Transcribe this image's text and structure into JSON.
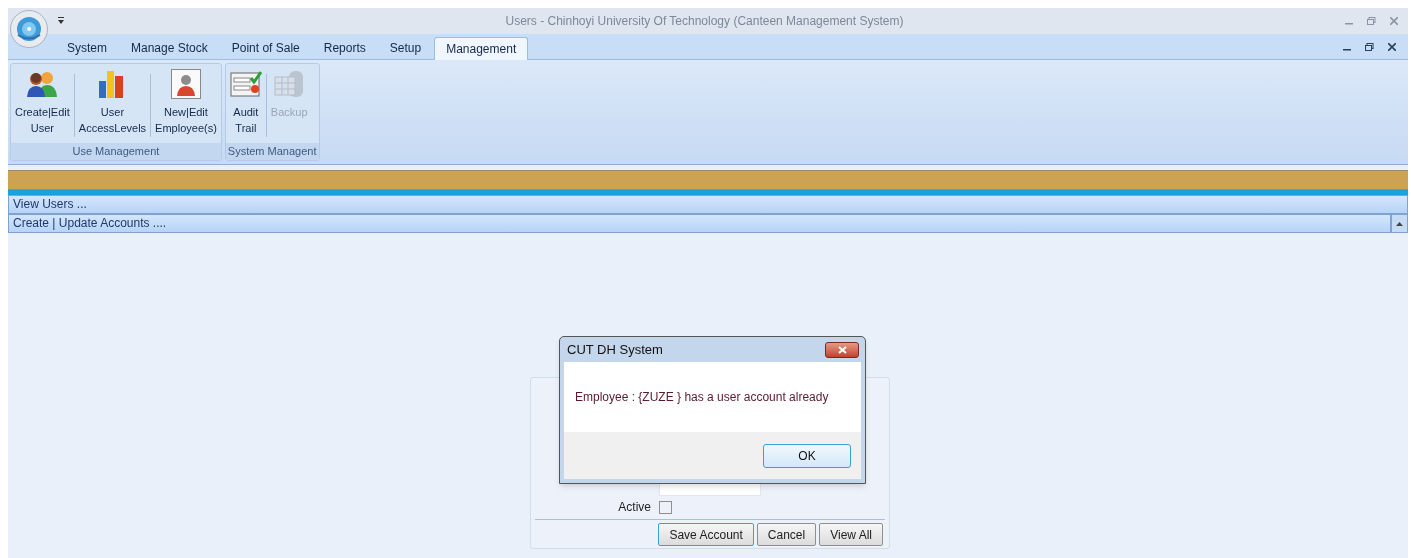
{
  "window": {
    "title": "Users - Chinhoyi University Of Technology (Canteen Management System)"
  },
  "tabs": [
    {
      "label": "System",
      "selected": false
    },
    {
      "label": "Manage Stock",
      "selected": false
    },
    {
      "label": "Point of Sale",
      "selected": false
    },
    {
      "label": "Reports",
      "selected": false
    },
    {
      "label": "Setup",
      "selected": false
    },
    {
      "label": "Management",
      "selected": true
    }
  ],
  "ribbon_groups": [
    {
      "label": "Use Management",
      "buttons": [
        {
          "kind": "users",
          "line_1": "Create|Edit",
          "line_2": "User",
          "disabled": false
        },
        {
          "kind": "chart",
          "line_1": "User",
          "line_2": "AccessLevels",
          "disabled": false
        },
        {
          "kind": "employee",
          "line_1": "New|Edit",
          "line_2": "Employee(s)",
          "disabled": false
        }
      ]
    },
    {
      "label": "System Managent",
      "buttons": [
        {
          "kind": "audit",
          "line_1": "Audit",
          "line_2": "Trail",
          "disabled": false
        },
        {
          "kind": "backup",
          "line_1": "Backup",
          "disabled": true
        }
      ]
    }
  ],
  "panels": [
    {
      "label": "View Users ...",
      "expanded": false
    },
    {
      "label": "Create | Update Accounts ....",
      "expanded": true
    }
  ],
  "form": {
    "active_label": "Active",
    "active_checked": false,
    "buttons": [
      {
        "label": "Save Account",
        "focused": true
      },
      {
        "label": "Cancel",
        "focused": false
      },
      {
        "label": "View All",
        "focused": false
      }
    ]
  },
  "dialog": {
    "title": "CUT DH System",
    "message": "Employee : {ZUZE } has a user account already",
    "button": "OK"
  }
}
